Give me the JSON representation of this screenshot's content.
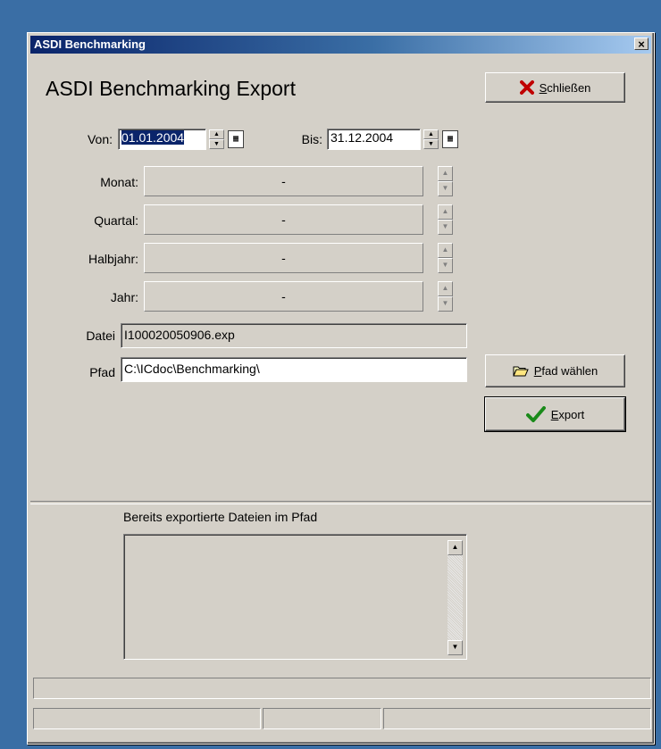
{
  "window": {
    "title": "ASDI Benchmarking",
    "close_glyph": "×"
  },
  "heading": "ASDI Benchmarking Export",
  "buttons": {
    "close": {
      "accel": "S",
      "rest": "chließen",
      "icon": "red-x-icon"
    },
    "choose_path": {
      "accel": "P",
      "rest": "fad wählen",
      "icon": "folder-open-icon"
    },
    "export": {
      "accel": "E",
      "rest": "xport",
      "icon": "green-check-icon"
    }
  },
  "dates": {
    "from_label": "Von:",
    "from_value": "01.01.2004",
    "to_label": "Bis:",
    "to_value": "31.12.2004"
  },
  "periods": [
    {
      "label": "Monat:",
      "value": "-"
    },
    {
      "label": "Quartal:",
      "value": "-"
    },
    {
      "label": "Halbjahr:",
      "value": "-"
    },
    {
      "label": "Jahr:",
      "value": "-"
    }
  ],
  "file": {
    "label": "Datei",
    "value": "I100020050906.exp"
  },
  "path": {
    "label": "Pfad",
    "value": "C:\\ICdoc\\Benchmarking\\"
  },
  "exported_list": {
    "label": "Bereits exportierte Dateien im Pfad",
    "items": []
  },
  "colors": {
    "accent": "#0a246a",
    "face": "#d4d0c8",
    "desktop": "#3a6ea5"
  }
}
